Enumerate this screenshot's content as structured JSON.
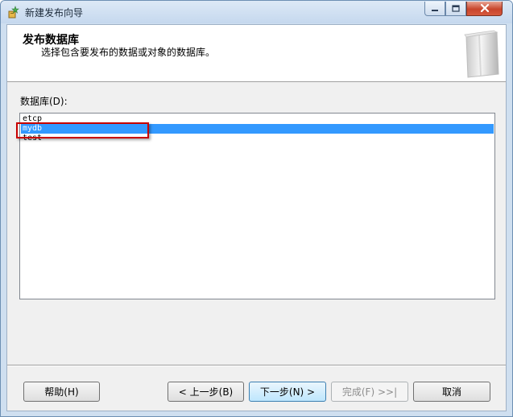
{
  "window": {
    "title": "新建发布向导",
    "icons": {
      "app": "wizard-app-icon",
      "minimize": "minimize-icon",
      "maximize": "maximize-icon",
      "close": "close-icon"
    }
  },
  "header": {
    "title": "发布数据库",
    "subtitle": "选择包含要发布的数据或对象的数据库。",
    "graphic": "database-cylinder-icon"
  },
  "database_list": {
    "label": "数据库(D):",
    "items": [
      {
        "name": "etcp",
        "selected": false
      },
      {
        "name": "mydb",
        "selected": true
      },
      {
        "name": "test",
        "selected": false
      }
    ],
    "selection_color": "#3399ff",
    "annotation_color": "#c80000"
  },
  "buttons": {
    "help": "帮助(H)",
    "back": "< 上一步(B)",
    "next": "下一步(N) >",
    "finish": "完成(F) >>|",
    "cancel": "取消"
  }
}
